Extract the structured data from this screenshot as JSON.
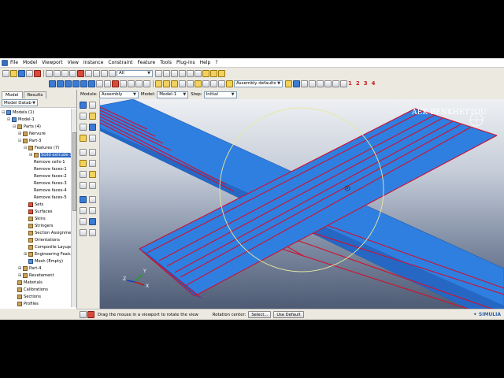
{
  "menu": [
    "File",
    "Model",
    "Viewport",
    "View",
    "Instance",
    "Constraint",
    "Feature",
    "Tools",
    "Plug-ins",
    "Help",
    "?"
  ],
  "toolbar": {
    "filter_value": "All",
    "assembly_defaults": "Assembly defaults",
    "view_numbers": [
      "1",
      "2",
      "3",
      "4"
    ]
  },
  "context": {
    "module_label": "Module:",
    "module_value": "Assembly",
    "model_label": "Model:",
    "model_value": "Model-1",
    "step_label": "Step:",
    "step_value": "Initial"
  },
  "left_panel": {
    "tabs": [
      "Model",
      "Results"
    ],
    "selector": "Model Datab"
  },
  "tree": [
    {
      "label": "Models (1)",
      "depth": 0,
      "exp": "−",
      "icon": "blue"
    },
    {
      "label": "Model-1",
      "depth": 1,
      "exp": "−",
      "icon": "blue"
    },
    {
      "label": "Parts (4)",
      "depth": 2,
      "exp": "−",
      "icon": "tan"
    },
    {
      "label": "Nervure",
      "depth": 3,
      "exp": "+",
      "icon": "tan"
    },
    {
      "label": "Part-3",
      "depth": 3,
      "exp": "−",
      "icon": "tan"
    },
    {
      "label": "Features (7)",
      "depth": 4,
      "exp": "−",
      "icon": "tan"
    },
    {
      "label": "Solid extrude-1",
      "depth": 5,
      "exp": "+",
      "icon": "tan",
      "selected": true
    },
    {
      "label": "Remove cells-1",
      "depth": 5,
      "exp": "",
      "icon": "none"
    },
    {
      "label": "Remove faces-1",
      "depth": 5,
      "exp": "",
      "icon": "none"
    },
    {
      "label": "Remove faces-2",
      "depth": 5,
      "exp": "",
      "icon": "none"
    },
    {
      "label": "Remove faces-3",
      "depth": 5,
      "exp": "",
      "icon": "none"
    },
    {
      "label": "Remove faces-4",
      "depth": 5,
      "exp": "",
      "icon": "none"
    },
    {
      "label": "Remove faces-5",
      "depth": 5,
      "exp": "",
      "icon": "none"
    },
    {
      "label": "Sets",
      "depth": 4,
      "exp": "",
      "icon": "red"
    },
    {
      "label": "Surfaces",
      "depth": 4,
      "exp": "",
      "icon": "red"
    },
    {
      "label": "Skins",
      "depth": 4,
      "exp": "",
      "icon": "tan"
    },
    {
      "label": "Stringers",
      "depth": 4,
      "exp": "",
      "icon": "tan"
    },
    {
      "label": "Section Assignmen",
      "depth": 4,
      "exp": "",
      "icon": "tan"
    },
    {
      "label": "Orientations",
      "depth": 4,
      "exp": "",
      "icon": "tan"
    },
    {
      "label": "Composite Layups",
      "depth": 4,
      "exp": "",
      "icon": "tan"
    },
    {
      "label": "Engineering Featu",
      "depth": 4,
      "exp": "+",
      "icon": "tan"
    },
    {
      "label": "Mesh (Empty)",
      "depth": 4,
      "exp": "",
      "icon": "blue"
    },
    {
      "label": "Part-4",
      "depth": 3,
      "exp": "+",
      "icon": "tan"
    },
    {
      "label": "Revetement",
      "depth": 3,
      "exp": "+",
      "icon": "tan"
    },
    {
      "label": "Materials",
      "depth": 2,
      "exp": "",
      "icon": "tan"
    },
    {
      "label": "Calibrations",
      "depth": 2,
      "exp": "",
      "icon": "tan"
    },
    {
      "label": "Sections",
      "depth": 2,
      "exp": "",
      "icon": "tan"
    },
    {
      "label": "Profiles",
      "depth": 2,
      "exp": "",
      "icon": "tan"
    }
  ],
  "viewport": {
    "watermark": "AEK BENKHETTOU",
    "part_color": "#2f7fe0",
    "edge_color": "#d01030",
    "rotation_circle_color": "#e8e8a0"
  },
  "status": {
    "prompt": "Drag the mouse in a viewport to rotate the view",
    "rotation_center_label": "Rotation center:",
    "select_button": "Select...",
    "use_default_button": "Use Default",
    "brand": "SIMULIA"
  }
}
